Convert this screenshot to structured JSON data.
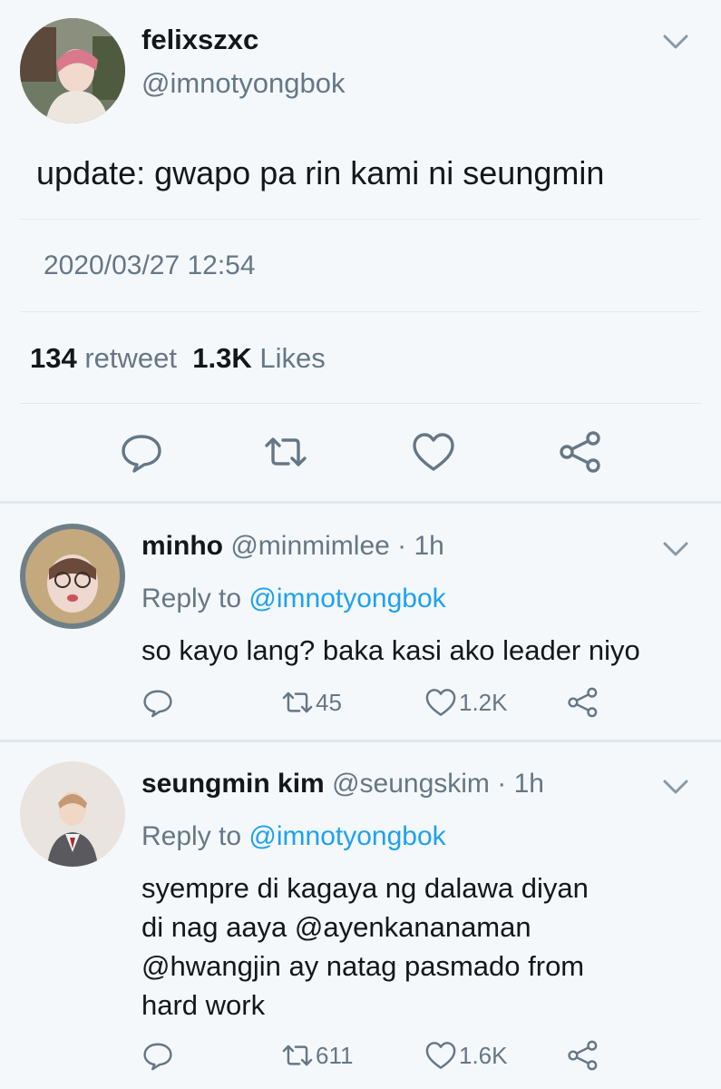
{
  "main_tweet": {
    "display_name": "felixszxc",
    "handle": "@imnotyongbok",
    "text": "update: gwapo pa rin kami ni seungmin",
    "timestamp": "2020/03/27 12:54",
    "retweet_count": "134",
    "retweet_label": "retweet",
    "like_count": "1.3K",
    "like_label": "Likes",
    "icons": [
      "reply-icon",
      "retweet-icon",
      "like-icon",
      "share-icon"
    ]
  },
  "replies": [
    {
      "display_name": "minho",
      "handle": "@minmimlee",
      "time": "· 1h",
      "reply_prefix": "Reply to",
      "reply_to": "@imnotyongbok",
      "lines": [
        "so kayo lang? baka kasi ako leader niyo"
      ],
      "retweet_count": "45",
      "like_count": "1.2K"
    },
    {
      "display_name": "seungmin kim",
      "handle": "@seungskim",
      "time": "· 1h",
      "reply_prefix": "Reply to",
      "reply_to": "@imnotyongbok",
      "lines": [
        "syempre di kagaya ng dalawa diyan",
        "di nag aaya @ayenkananaman",
        "@hwangjin ay natag pasmado from",
        "hard work"
      ],
      "retweet_count": "611",
      "like_count": "1.6K"
    }
  ],
  "colors": {
    "background": "#f5f8fa",
    "text": "#14171a",
    "secondary": "#657786",
    "link": "#1da1f2",
    "divider": "#e1e8ed"
  }
}
